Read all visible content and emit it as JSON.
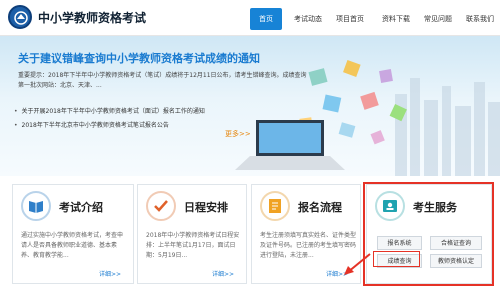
{
  "header": {
    "site_title": "中小学教师资格考试",
    "nav": [
      "首页",
      "考试动态",
      "项目首页",
      "资料下载",
      "常见问题",
      "联系我们"
    ]
  },
  "banner": {
    "title": "关于建议错峰查询中小学教师资格考试成绩的通知",
    "body": "重要提示：2018年下半年中小学教师资格考试（笔试）成绩将于12月11日公布，请考生错峰查询。成绩查询第一批次网站：北京、天津、...",
    "bullets": [
      "关于开展2018年下半年中小学教师资格考试（面试）报名工作的通知",
      "2018年下半年北京市中小学教师资格考试笔试报名公告"
    ],
    "more": "更多>>"
  },
  "cards": [
    {
      "title": "考试介绍",
      "text": "通过实施中小学教师资格考试，考查申请人是否具备教师职业道德、基本素养、教育教学能...",
      "more": "详细>>"
    },
    {
      "title": "日程安排",
      "text": "2018年中小学教师资格考试日程安排：上半年笔试1月17日，面试日期：5月19日...",
      "more": "详细>>"
    },
    {
      "title": "报名流程",
      "text": "考生注册须填写真实姓名、证件类型及证件号码。已注册的考生填写密码进行登陆，未注册...",
      "more": "详细>>"
    },
    {
      "title": "考生服务",
      "buttons": [
        "报名系统",
        "合格证查询",
        "成绩查询",
        "教师资格认定"
      ]
    }
  ],
  "colors": {
    "accent": "#1783d6",
    "banner_title": "#1a7bd0",
    "highlight": "#e53226"
  }
}
